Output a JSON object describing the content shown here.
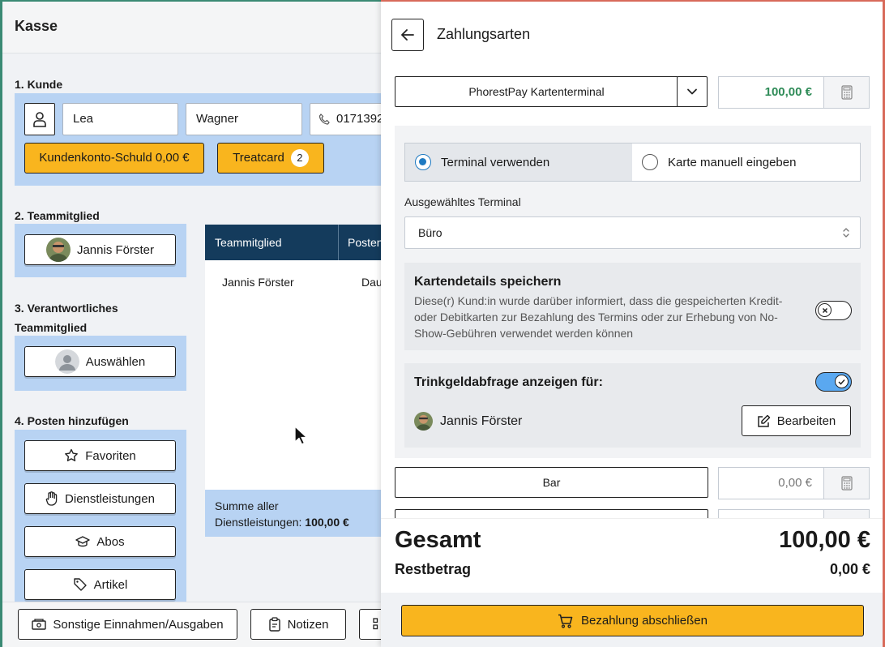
{
  "left": {
    "title": "Kasse",
    "customer": {
      "section": "1. Kunde",
      "first_name": "Lea",
      "last_name": "Wagner",
      "phone": "0171392",
      "debt_button": "Kundenkonto-Schuld 0,00 €",
      "treatcard_button": "Treatcard",
      "treatcard_count": "2"
    },
    "team": {
      "section": "2. Teammitglied",
      "member": "Jannis Förster"
    },
    "responsible": {
      "section_line1": "3. Verantwortliches",
      "section_line2": "Teammitglied",
      "select_label": "Auswählen"
    },
    "items": {
      "section": "4. Posten hinzufügen",
      "buttons": [
        "Favoriten",
        "Dienstleistungen",
        "Abos",
        "Artikel"
      ]
    },
    "table": {
      "headers": [
        "Teammitglied",
        "Posten"
      ],
      "rows": [
        {
          "member": "Jannis Förster",
          "item": "Dau"
        }
      ],
      "sum_label": "Summe aller",
      "sum_label2": "Dienstleistungen:",
      "sum_value": "100,00 €"
    },
    "bottom": {
      "other": "Sonstige Einnahmen/Ausgaben",
      "notes": "Notizen"
    }
  },
  "panel": {
    "title": "Zahlungsarten",
    "methods": {
      "terminal_name": "PhorestPay Kartenterminal",
      "terminal_amount": "100,00 €",
      "cash_name": "Bar",
      "cash_amount": "0,00 €"
    },
    "card": {
      "radio_terminal": "Terminal verwenden",
      "radio_manual": "Karte manuell eingeben",
      "terminal_label": "Ausgewähltes Terminal",
      "terminal_value": "Büro",
      "save_title": "Kartendetails speichern",
      "save_desc_1": "Diese(r) Kund:in wurde darüber informiert, dass die gespeicherten Kredit-",
      "save_desc_2": "oder Debitkarten zur Bezahlung des Termins oder zur Erhebung von No-",
      "save_desc_3": "Show-Gebühren verwendet werden können",
      "save_enabled": false,
      "tip_title": "Trinkgeldabfrage anzeigen für:",
      "tip_enabled": true,
      "tip_member": "Jannis Förster",
      "edit_button": "Bearbeiten"
    },
    "totals": {
      "total_label": "Gesamt",
      "total_value": "100,00 €",
      "rest_label": "Restbetrag",
      "rest_value": "0,00 €"
    },
    "pay_button": "Bezahlung abschließen"
  },
  "colors": {
    "accent_orange": "#f9b51e",
    "light_blue": "#b8d3f3",
    "navy": "#143b5c",
    "green_amount": "#2e8b57",
    "toggle_on": "#5aa8f0"
  }
}
